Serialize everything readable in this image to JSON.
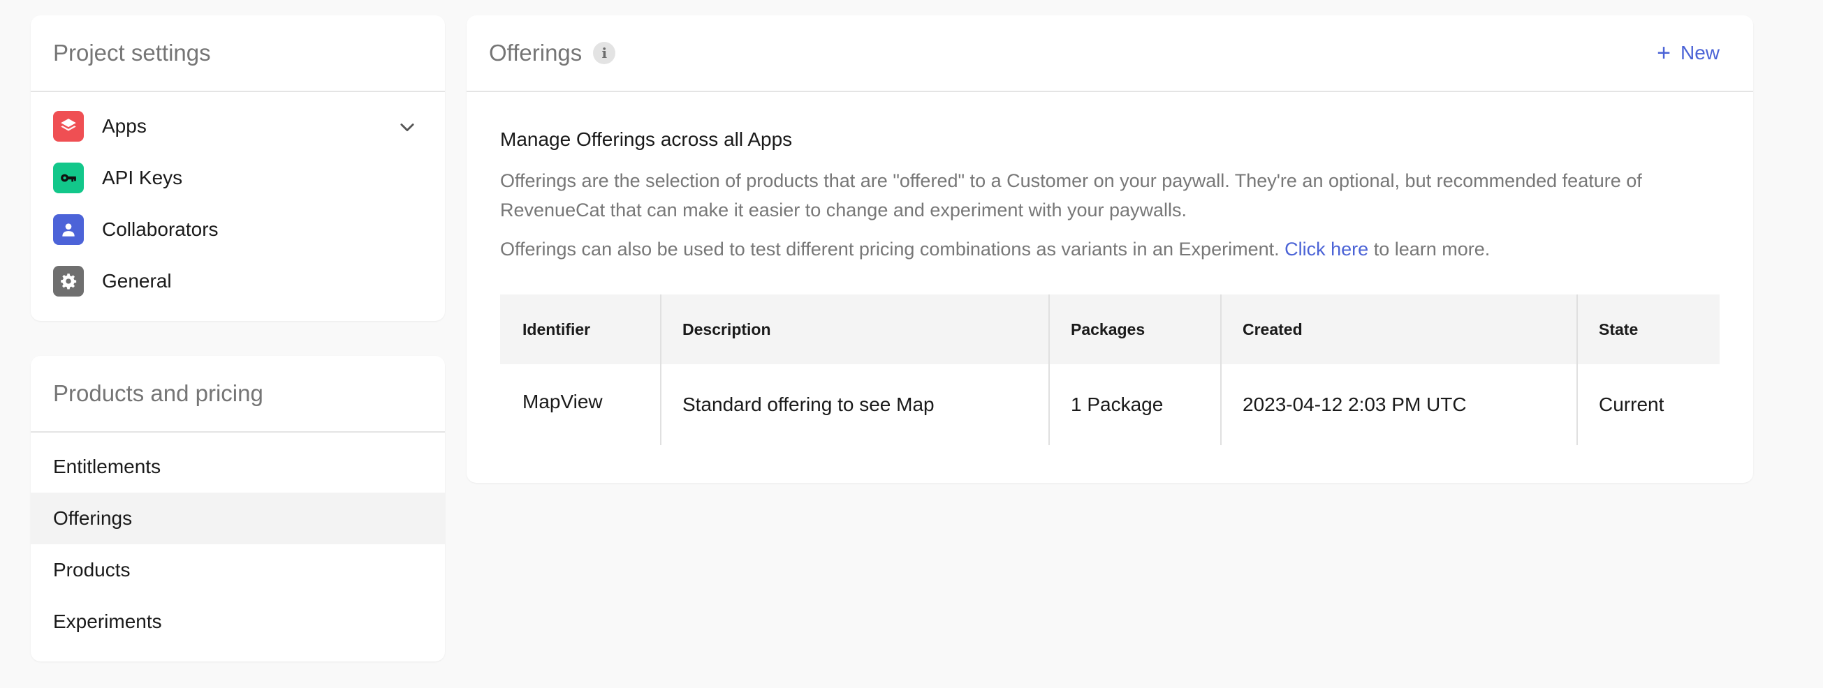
{
  "project_settings": {
    "title": "Project settings",
    "items": [
      {
        "label": "Apps",
        "icon": "layers-icon",
        "color": "#ef4f53"
      },
      {
        "label": "API Keys",
        "icon": "key-icon",
        "color": "#12c78a"
      },
      {
        "label": "Collaborators",
        "icon": "user-icon",
        "color": "#4c63d8"
      },
      {
        "label": "General",
        "icon": "gear-icon",
        "color": "#6f6f6f"
      }
    ]
  },
  "products_pricing": {
    "title": "Products and pricing",
    "items": [
      {
        "label": "Entitlements"
      },
      {
        "label": "Offerings"
      },
      {
        "label": "Products"
      },
      {
        "label": "Experiments"
      }
    ]
  },
  "offerings": {
    "title": "Offerings",
    "info_glyph": "i",
    "new_button": "New",
    "new_plus": "+",
    "section_title": "Manage Offerings across all Apps",
    "paragraph_1": "Offerings are the selection of products that are \"offered\" to a Customer on your paywall. They're an optional, but recommended feature of RevenueCat that can make it easier to change and experiment with your paywalls.",
    "paragraph_2_prefix": "Offerings can also be used to test different pricing combinations as variants in an Experiment.",
    "paragraph_2_link": "Click here",
    "paragraph_2_suffix": "to learn more.",
    "table": {
      "headers": [
        "Identifier",
        "Description",
        "Packages",
        "Created",
        "State"
      ],
      "rows": [
        [
          "MapView",
          "Standard offering to see Map",
          "1 Package",
          "2023-04-12 2:03 PM UTC",
          "Current"
        ]
      ]
    }
  },
  "colors": {
    "accent": "#4b63d6",
    "muted_text": "#777777"
  }
}
